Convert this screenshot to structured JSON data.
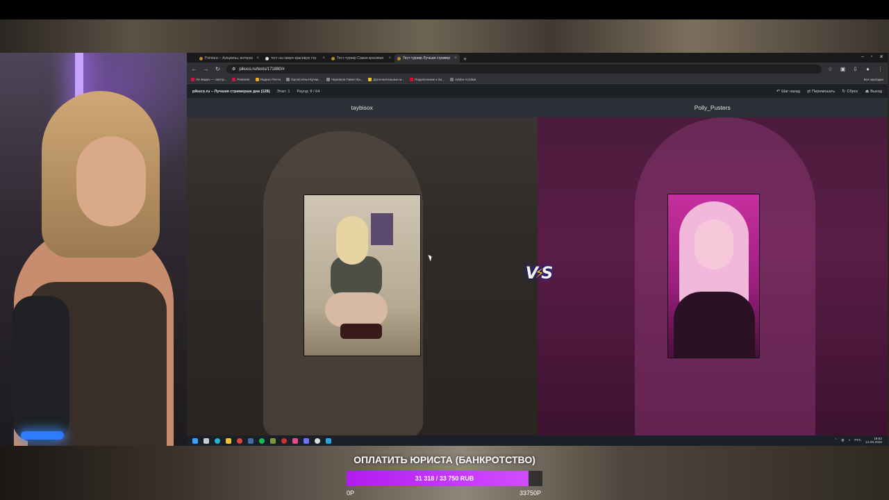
{
  "browser": {
    "tabs": [
      {
        "label": "Pointauc – Аукционы, интерак"
      },
      {
        "label": "тест на самую красивую стр"
      },
      {
        "label": "Тест-турнир Самая красивая"
      },
      {
        "label": "Тест-турнир Лучшая стример"
      }
    ],
    "new_tab": "+",
    "url": "pikuco.ru/tests/171880/#",
    "bookmarks": [
      {
        "label": "VK Видео — смотр..."
      },
      {
        "label": "Pinterest"
      },
      {
        "label": "Яндекс Почта"
      },
      {
        "label": "Орлов Илья Кучак..."
      },
      {
        "label": "Черняков Павел Ва..."
      },
      {
        "label": "Дополнительные м..."
      },
      {
        "label": "Подключение к За..."
      },
      {
        "label": "Adobe Acrobat"
      }
    ],
    "bookmarks_all": "Все закладки"
  },
  "site": {
    "title": "pikuco.ru – Лучшая стримерша дна (128)",
    "stage": "Этап: 1",
    "round": "Раунд: 8 / 64",
    "actions": [
      {
        "icon": "undo-icon",
        "label": "Шаг назад"
      },
      {
        "icon": "shuffle-icon",
        "label": "Перемешать"
      },
      {
        "icon": "reset-icon",
        "label": "Сброс"
      },
      {
        "icon": "exit-icon",
        "label": "Выход"
      }
    ]
  },
  "contestants": {
    "left": {
      "name": "taybisox"
    },
    "right": {
      "name": "Polly_Pusters"
    }
  },
  "vs": {
    "v": "V",
    "s": "S",
    "bolt": "⚡"
  },
  "taskbar": {
    "lang": "РУС",
    "time": "19:52",
    "date": "14.08.2026"
  },
  "goal": {
    "title": "ОПЛАТИТЬ ЮРИСТА (БАНКРОТСТВО)",
    "progress_text": "31 318 / 33 750 RUB",
    "progress_fraction": 0.928,
    "min_label": "0Р",
    "max_label": "33750Р",
    "fill_color": "#c430f5"
  }
}
